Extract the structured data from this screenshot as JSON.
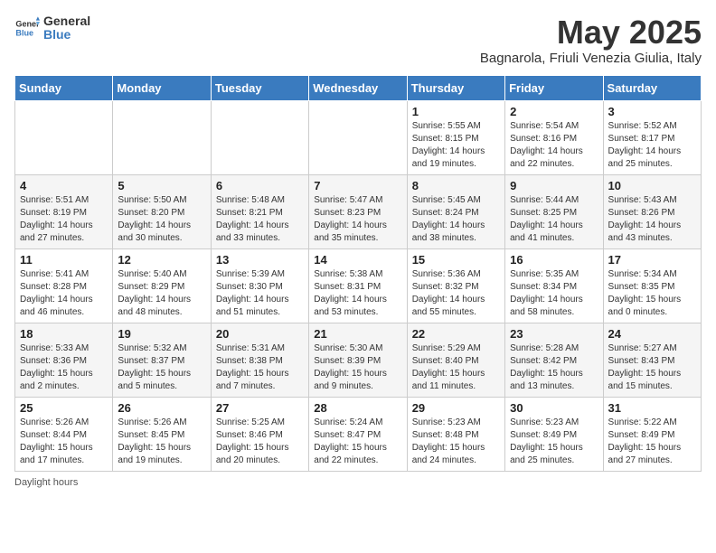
{
  "header": {
    "logo_general": "General",
    "logo_blue": "Blue",
    "title": "May 2025",
    "subtitle": "Bagnarola, Friuli Venezia Giulia, Italy"
  },
  "days_of_week": [
    "Sunday",
    "Monday",
    "Tuesday",
    "Wednesday",
    "Thursday",
    "Friday",
    "Saturday"
  ],
  "weeks": [
    [
      {
        "day": "",
        "info": ""
      },
      {
        "day": "",
        "info": ""
      },
      {
        "day": "",
        "info": ""
      },
      {
        "day": "",
        "info": ""
      },
      {
        "day": "1",
        "info": "Sunrise: 5:55 AM\nSunset: 8:15 PM\nDaylight: 14 hours\nand 19 minutes."
      },
      {
        "day": "2",
        "info": "Sunrise: 5:54 AM\nSunset: 8:16 PM\nDaylight: 14 hours\nand 22 minutes."
      },
      {
        "day": "3",
        "info": "Sunrise: 5:52 AM\nSunset: 8:17 PM\nDaylight: 14 hours\nand 25 minutes."
      }
    ],
    [
      {
        "day": "4",
        "info": "Sunrise: 5:51 AM\nSunset: 8:19 PM\nDaylight: 14 hours\nand 27 minutes."
      },
      {
        "day": "5",
        "info": "Sunrise: 5:50 AM\nSunset: 8:20 PM\nDaylight: 14 hours\nand 30 minutes."
      },
      {
        "day": "6",
        "info": "Sunrise: 5:48 AM\nSunset: 8:21 PM\nDaylight: 14 hours\nand 33 minutes."
      },
      {
        "day": "7",
        "info": "Sunrise: 5:47 AM\nSunset: 8:23 PM\nDaylight: 14 hours\nand 35 minutes."
      },
      {
        "day": "8",
        "info": "Sunrise: 5:45 AM\nSunset: 8:24 PM\nDaylight: 14 hours\nand 38 minutes."
      },
      {
        "day": "9",
        "info": "Sunrise: 5:44 AM\nSunset: 8:25 PM\nDaylight: 14 hours\nand 41 minutes."
      },
      {
        "day": "10",
        "info": "Sunrise: 5:43 AM\nSunset: 8:26 PM\nDaylight: 14 hours\nand 43 minutes."
      }
    ],
    [
      {
        "day": "11",
        "info": "Sunrise: 5:41 AM\nSunset: 8:28 PM\nDaylight: 14 hours\nand 46 minutes."
      },
      {
        "day": "12",
        "info": "Sunrise: 5:40 AM\nSunset: 8:29 PM\nDaylight: 14 hours\nand 48 minutes."
      },
      {
        "day": "13",
        "info": "Sunrise: 5:39 AM\nSunset: 8:30 PM\nDaylight: 14 hours\nand 51 minutes."
      },
      {
        "day": "14",
        "info": "Sunrise: 5:38 AM\nSunset: 8:31 PM\nDaylight: 14 hours\nand 53 minutes."
      },
      {
        "day": "15",
        "info": "Sunrise: 5:36 AM\nSunset: 8:32 PM\nDaylight: 14 hours\nand 55 minutes."
      },
      {
        "day": "16",
        "info": "Sunrise: 5:35 AM\nSunset: 8:34 PM\nDaylight: 14 hours\nand 58 minutes."
      },
      {
        "day": "17",
        "info": "Sunrise: 5:34 AM\nSunset: 8:35 PM\nDaylight: 15 hours\nand 0 minutes."
      }
    ],
    [
      {
        "day": "18",
        "info": "Sunrise: 5:33 AM\nSunset: 8:36 PM\nDaylight: 15 hours\nand 2 minutes."
      },
      {
        "day": "19",
        "info": "Sunrise: 5:32 AM\nSunset: 8:37 PM\nDaylight: 15 hours\nand 5 minutes."
      },
      {
        "day": "20",
        "info": "Sunrise: 5:31 AM\nSunset: 8:38 PM\nDaylight: 15 hours\nand 7 minutes."
      },
      {
        "day": "21",
        "info": "Sunrise: 5:30 AM\nSunset: 8:39 PM\nDaylight: 15 hours\nand 9 minutes."
      },
      {
        "day": "22",
        "info": "Sunrise: 5:29 AM\nSunset: 8:40 PM\nDaylight: 15 hours\nand 11 minutes."
      },
      {
        "day": "23",
        "info": "Sunrise: 5:28 AM\nSunset: 8:42 PM\nDaylight: 15 hours\nand 13 minutes."
      },
      {
        "day": "24",
        "info": "Sunrise: 5:27 AM\nSunset: 8:43 PM\nDaylight: 15 hours\nand 15 minutes."
      }
    ],
    [
      {
        "day": "25",
        "info": "Sunrise: 5:26 AM\nSunset: 8:44 PM\nDaylight: 15 hours\nand 17 minutes."
      },
      {
        "day": "26",
        "info": "Sunrise: 5:26 AM\nSunset: 8:45 PM\nDaylight: 15 hours\nand 19 minutes."
      },
      {
        "day": "27",
        "info": "Sunrise: 5:25 AM\nSunset: 8:46 PM\nDaylight: 15 hours\nand 20 minutes."
      },
      {
        "day": "28",
        "info": "Sunrise: 5:24 AM\nSunset: 8:47 PM\nDaylight: 15 hours\nand 22 minutes."
      },
      {
        "day": "29",
        "info": "Sunrise: 5:23 AM\nSunset: 8:48 PM\nDaylight: 15 hours\nand 24 minutes."
      },
      {
        "day": "30",
        "info": "Sunrise: 5:23 AM\nSunset: 8:49 PM\nDaylight: 15 hours\nand 25 minutes."
      },
      {
        "day": "31",
        "info": "Sunrise: 5:22 AM\nSunset: 8:49 PM\nDaylight: 15 hours\nand 27 minutes."
      }
    ]
  ],
  "footer": {
    "note": "Daylight hours"
  }
}
